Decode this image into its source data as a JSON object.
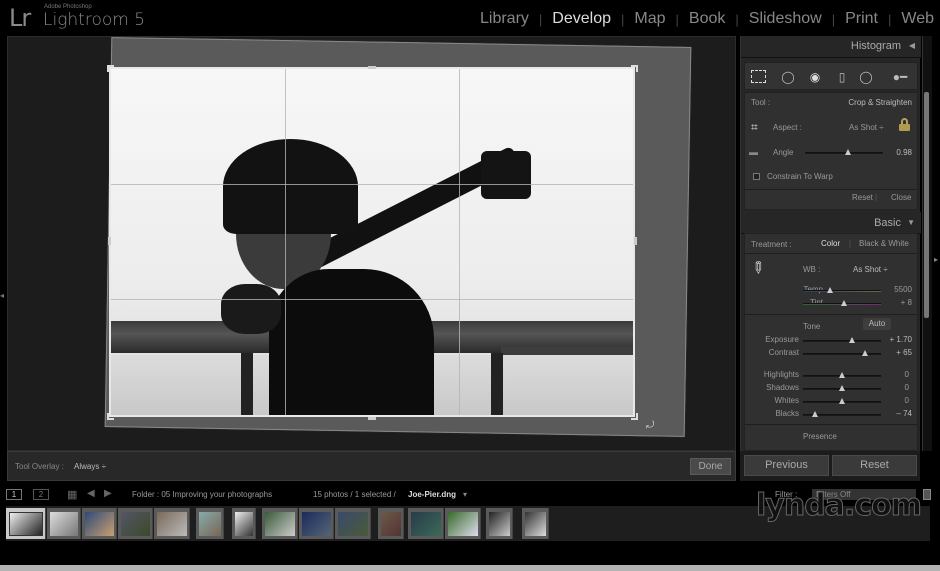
{
  "app": {
    "logo": "Lr",
    "vendor": "Adobe Photoshop",
    "name": "Lightroom 5"
  },
  "modules": [
    {
      "label": "Library",
      "active": false
    },
    {
      "label": "Develop",
      "active": true
    },
    {
      "label": "Map",
      "active": false
    },
    {
      "label": "Book",
      "active": false
    },
    {
      "label": "Slideshow",
      "active": false
    },
    {
      "label": "Print",
      "active": false
    },
    {
      "label": "Web",
      "active": false
    }
  ],
  "toolbar": {
    "tool_overlay_label": "Tool Overlay :",
    "tool_overlay_value": "Always ÷",
    "done_label": "Done"
  },
  "right_panel": {
    "histogram_title": "Histogram",
    "tool_strip_icons": [
      "crop-overlay-icon",
      "spot-removal-icon",
      "red-eye-icon",
      "graduated-filter-icon",
      "radial-filter-icon",
      "adjustment-brush-icon"
    ],
    "crop": {
      "tool_label": "Tool :",
      "tool_value": "Crop & Straighten",
      "aspect_label": "Aspect :",
      "aspect_value": "As Shot ÷",
      "aspect_locked": true,
      "angle_label": "Angle",
      "angle_value": "0.98",
      "angle_position": 0.55,
      "constrain_label": "Constrain To Warp",
      "constrain_checked": false,
      "reset_label": "Reset",
      "close_label": "Close"
    },
    "basic": {
      "title": "Basic",
      "treatment_label": "Treatment :",
      "treatment_color": "Color",
      "treatment_bw": "Black & White",
      "wb_label": "WB :",
      "wb_value": "As Shot ÷",
      "temp_label": "Temp",
      "temp_value": "5500",
      "temp_position": 0.35,
      "tint_label": "Tint",
      "tint_value": "+ 8",
      "tint_position": 0.52,
      "tone_label": "Tone",
      "auto_label": "Auto",
      "exposure_label": "Exposure",
      "exposure_value": "+ 1.70",
      "exposure_position": 0.63,
      "contrast_label": "Contrast",
      "contrast_value": "+ 65",
      "contrast_position": 0.8,
      "highlights_label": "Highlights",
      "highlights_value": "0",
      "highlights_position": 0.5,
      "shadows_label": "Shadows",
      "shadows_value": "0",
      "shadows_position": 0.5,
      "whites_label": "Whites",
      "whites_value": "0",
      "whites_position": 0.5,
      "blacks_label": "Blacks",
      "blacks_value": "– 74",
      "blacks_position": 0.16,
      "presence_label": "Presence"
    },
    "previous_label": "Previous",
    "reset_label": "Reset"
  },
  "filmstrip_bar": {
    "screen1": "1",
    "screen2": "2",
    "folder_text": "Folder : 05 Improving your photographs",
    "count_text": "15 photos / 1 selected /",
    "filename": "Joe-Pier.dng",
    "filter_label": "Filter :",
    "filter_value": "Filters Off"
  },
  "filmstrip": {
    "count": 15,
    "selected_index": 0
  },
  "watermark": "lynda.com"
}
